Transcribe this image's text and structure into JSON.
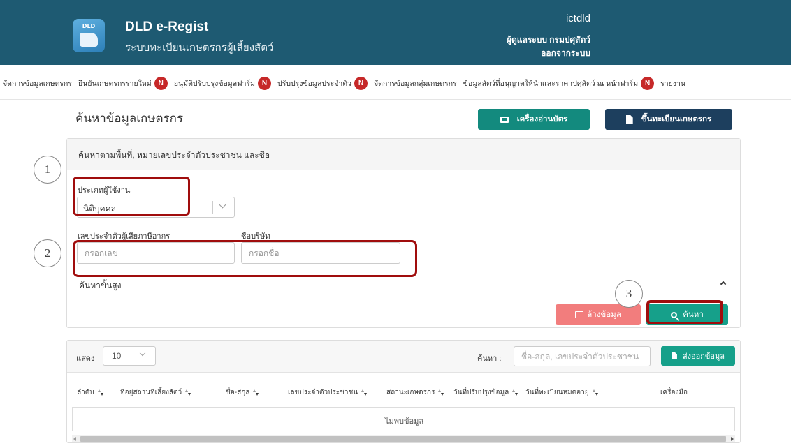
{
  "header": {
    "logo_text": "DLD",
    "app_title": "DLD e-Regist",
    "app_subtitle": "ระบบทะเบียนเกษตรกรผู้เลี้ยงสัตว์",
    "user_name": "ictdld",
    "user_role": "ผู้ดูแลระบบ กรมปศุสัตว์",
    "logout_label": "ออกจากระบบ",
    "background_color": "#1e5a72"
  },
  "nav": [
    {
      "label": "จัดการข้อมูลเกษตรกร",
      "badge": ""
    },
    {
      "label": "ยืนยันเกษตรกรรายใหม่",
      "badge": "N"
    },
    {
      "label": "อนุมัติปรับปรุงข้อมูลฟาร์ม",
      "badge": "N"
    },
    {
      "label": "ปรับปรุงข้อมูลประจำตัว",
      "badge": "N"
    },
    {
      "label": "จัดการข้อมูลกลุ่มเกษตรกร",
      "badge": ""
    },
    {
      "label": "ข้อมูลสัตว์ที่อนุญาตให้นำและราคาปศุสัตว์ ณ หน้าฟาร์ม",
      "badge": "N"
    },
    {
      "label": "รายงาน",
      "badge": ""
    }
  ],
  "page": {
    "title": "ค้นหาข้อมูลเกษตรกร",
    "card_reader_button": "เครื่องอ่านบัตร",
    "register_button": "ขึ้นทะเบียนเกษตรกร"
  },
  "search_panel": {
    "heading": "ค้นหาตามพื้นที่, หมายเลขประจำตัวประชาชน และชื่อ",
    "user_type_label": "ประเภทผู้ใช้งาน",
    "user_type_value": "นิติบุคคล",
    "tax_id_label": "เลขประจำตัวผู้เสียภาษีอากร",
    "tax_id_placeholder": "กรอกเลข",
    "company_label": "ชื่อบริษัท",
    "company_placeholder": "กรอกชื่อ",
    "advanced_label": "ค้นหาขั้นสูง",
    "clear_button": "ล้างข้อมูล",
    "search_button": "ค้นหา"
  },
  "annotations": [
    "1",
    "2",
    "3"
  ],
  "table": {
    "show_label": "แสดง",
    "page_size": "10",
    "search_label": "ค้นหา :",
    "search_placeholder": "ชื่อ-สกุล, เลขประจำตัวประชาชน",
    "export_button": "ส่งออกข้อมูล",
    "columns": [
      "ลำดับ",
      "ที่อยู่สถานที่เลี้ยงสัตว์",
      "ชื่อ-สกุล",
      "เลขประจำตัวประชาชน",
      "สถานะเกษตรกร",
      "วันที่ปรับปรุงข้อมูล",
      "วันที่ทะเบียนหมดอายุ",
      "เครื่องมือ"
    ],
    "empty_text": "ไม่พบข้อมูล"
  },
  "colors": {
    "accent_teal": "#16a08a",
    "navy": "#1d3f5e",
    "danger": "#c62828",
    "clear_button": "#f27d7d",
    "annotation_red": "#a00d0d"
  },
  "icons": [
    "card-reader-icon",
    "document-icon",
    "search-icon",
    "eraser-icon",
    "chevron-down-icon",
    "chevron-up-icon",
    "sort-icon"
  ]
}
